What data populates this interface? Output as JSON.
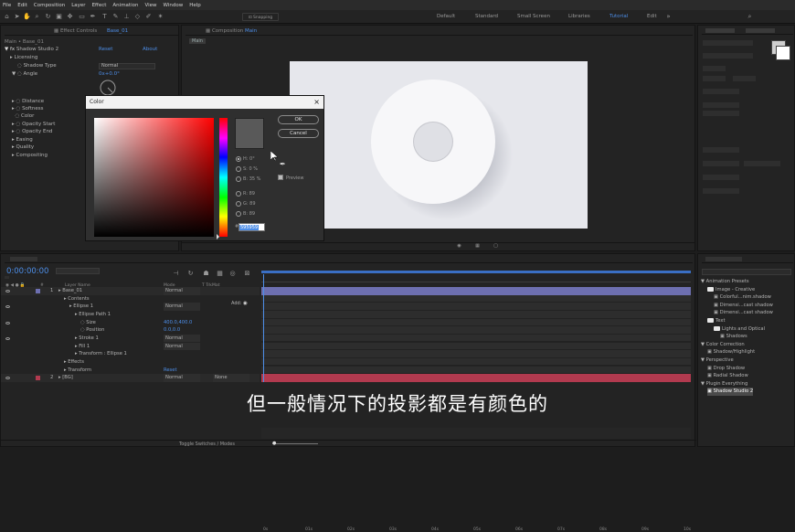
{
  "menubar": [
    "File",
    "Edit",
    "Composition",
    "Layer",
    "Effect",
    "Animation",
    "View",
    "Window",
    "Help"
  ],
  "workspaces": [
    {
      "label": "Default",
      "active": false
    },
    {
      "label": "Standard",
      "active": false
    },
    {
      "label": "Small Screen",
      "active": false
    },
    {
      "label": "Libraries",
      "active": false
    },
    {
      "label": "Tutorial",
      "active": true
    },
    {
      "label": "Edit",
      "active": false
    }
  ],
  "effect_controls": {
    "tab": "Base_01",
    "layer_line": "Main • Base_01",
    "effect_name": "Shadow Studio 2",
    "reset": "Reset",
    "about": "About",
    "items": [
      "Licensing",
      "Shadow Type",
      "Angle"
    ],
    "shadow_type_value": "Normal",
    "angle_value": "0x+0.0°",
    "props": [
      "Distance",
      "Softness",
      "Color",
      "Opacity Start",
      "Opacity End",
      "Easing",
      "Quality",
      "Compositing"
    ]
  },
  "comp": {
    "tab_label": "Main",
    "sub_tab": "Main"
  },
  "color_dialog": {
    "title": "Color",
    "close": "×",
    "ok": "OK",
    "cancel": "Cancel",
    "preview": "Preview",
    "hue_label": "H: 0°",
    "sat_label": "S: 0 %",
    "bri_label": "B: 35 %",
    "r_label": "R: 89",
    "g_label": "G: 89",
    "b_label": "B: 89",
    "hex": "595959",
    "hex_prefix": "#",
    "swatch_color": "#595959"
  },
  "timeline": {
    "timecode": "0:00:00:00",
    "header": {
      "num": "#",
      "name": "Layer Name",
      "mode": "Mode",
      "trkmat": "T TrkMat",
      "parent": "Parent"
    },
    "add_label": "Add:",
    "rows": [
      {
        "indent": 0,
        "num": "1",
        "name": "Base_01",
        "mode": "Normal",
        "type": "layer"
      },
      {
        "indent": 1,
        "num": "",
        "name": "Contents",
        "mode": "",
        "type": "group"
      },
      {
        "indent": 2,
        "num": "",
        "name": "Ellipse 1",
        "mode": "Normal",
        "type": "group"
      },
      {
        "indent": 3,
        "num": "",
        "name": "Ellipse Path 1",
        "mode": "",
        "type": "group"
      },
      {
        "indent": 4,
        "num": "",
        "name": "Size",
        "mode": "400.0,400.0",
        "type": "prop"
      },
      {
        "indent": 4,
        "num": "",
        "name": "Position",
        "mode": "0.0,0.0",
        "type": "prop"
      },
      {
        "indent": 3,
        "num": "",
        "name": "Stroke 1",
        "mode": "Normal",
        "type": "group"
      },
      {
        "indent": 3,
        "num": "",
        "name": "Fill 1",
        "mode": "Normal",
        "type": "group"
      },
      {
        "indent": 3,
        "num": "",
        "name": "Transform : Ellipse 1",
        "mode": "",
        "type": "group"
      },
      {
        "indent": 1,
        "num": "",
        "name": "Effects",
        "mode": "",
        "type": "group"
      },
      {
        "indent": 1,
        "num": "",
        "name": "Transform",
        "mode": "Reset",
        "type": "group"
      },
      {
        "indent": 0,
        "num": "2",
        "name": "[BG]",
        "mode": "Normal",
        "type": "layer"
      }
    ],
    "trkmat_value": "None",
    "ruler": [
      "0s",
      "01s",
      "02s",
      "03s",
      "04s",
      "05s",
      "06s",
      "07s",
      "08s",
      "09s",
      "10s"
    ],
    "footer": "Toggle Switches / Modes"
  },
  "project": {
    "rows": [
      {
        "indent": 0,
        "label": "Animation Presets",
        "kind": "tri"
      },
      {
        "indent": 1,
        "label": "Image - Creative",
        "kind": "folder"
      },
      {
        "indent": 2,
        "label": "Colorful...nim.shadow",
        "kind": "file"
      },
      {
        "indent": 2,
        "label": "Dimensi...cast shadow",
        "kind": "file"
      },
      {
        "indent": 2,
        "label": "Dimensi...cast shadow",
        "kind": "file"
      },
      {
        "indent": 1,
        "label": "Text",
        "kind": "folder"
      },
      {
        "indent": 2,
        "label": "Lights and Optical",
        "kind": "folder"
      },
      {
        "indent": 3,
        "label": "Shadows",
        "kind": "file"
      },
      {
        "indent": 0,
        "label": "Color Correction",
        "kind": "tri"
      },
      {
        "indent": 1,
        "label": "Shadow/Highlight",
        "kind": "file"
      },
      {
        "indent": 0,
        "label": "Perspective",
        "kind": "tri"
      },
      {
        "indent": 1,
        "label": "Drop Shadow",
        "kind": "file"
      },
      {
        "indent": 1,
        "label": "Radial Shadow",
        "kind": "file"
      },
      {
        "indent": 0,
        "label": "Plugin Everything",
        "kind": "tri"
      },
      {
        "indent": 1,
        "label": "Shadow Studio 2",
        "kind": "file",
        "selected": true
      }
    ]
  },
  "subtitle": "但一般情况下的投影都是有颜色的",
  "colors": {
    "accent": "#4d8ee8",
    "bg": "#1d1d1d",
    "panel": "#232323",
    "bg_layer": "#b23a4f",
    "layer_bar": "#6d6fb0"
  }
}
